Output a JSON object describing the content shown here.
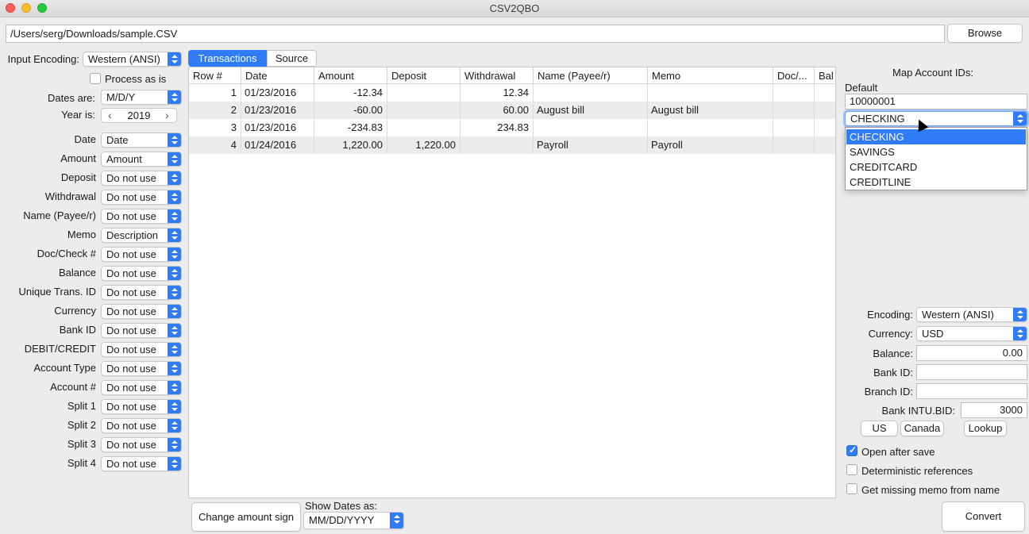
{
  "window": {
    "title": "CSV2QBO"
  },
  "file": {
    "path": "/Users/serg/Downloads/sample.CSV",
    "browse_label": "Browse"
  },
  "left": {
    "input_encoding_label": "Input Encoding:",
    "input_encoding_value": "Western (ANSI)",
    "process_as_is_label": "Process as is",
    "dates_are_label": "Dates are:",
    "dates_are_value": "M/D/Y",
    "year_label": "Year is:",
    "year_value": "2019",
    "year_prev": "‹",
    "year_next": "›",
    "mappings": [
      {
        "label": "Date",
        "value": "Date"
      },
      {
        "label": "Amount",
        "value": "Amount"
      },
      {
        "label": "Deposit",
        "value": "Do not use"
      },
      {
        "label": "Withdrawal",
        "value": "Do not use"
      },
      {
        "label": "Name (Payee/r)",
        "value": "Do not use"
      },
      {
        "label": "Memo",
        "value": "Description"
      },
      {
        "label": "Doc/Check #",
        "value": "Do not use"
      },
      {
        "label": "Balance",
        "value": "Do not use"
      },
      {
        "label": "Unique Trans. ID",
        "value": "Do not use"
      },
      {
        "label": "Currency",
        "value": "Do not use"
      },
      {
        "label": "Bank ID",
        "value": "Do not use"
      },
      {
        "label": "DEBIT/CREDIT",
        "value": "Do not use"
      },
      {
        "label": "Account Type",
        "value": "Do not use"
      },
      {
        "label": "Account #",
        "value": "Do not use"
      },
      {
        "label": "Split 1",
        "value": "Do not use"
      },
      {
        "label": "Split 2",
        "value": "Do not use"
      },
      {
        "label": "Split 3",
        "value": "Do not use"
      },
      {
        "label": "Split 4",
        "value": "Do not use"
      }
    ]
  },
  "tabs": [
    {
      "label": "Transactions"
    },
    {
      "label": "Source"
    }
  ],
  "table": {
    "columns": [
      "Row #",
      "Date",
      "Amount",
      "Deposit",
      "Withdrawal",
      "Name (Payee/r)",
      "Memo",
      "Doc/...",
      "Bal"
    ],
    "rows": [
      [
        "1",
        "01/23/2016",
        "-12.34",
        "",
        "12.34",
        "",
        "",
        "",
        ""
      ],
      [
        "2",
        "01/23/2016",
        "-60.00",
        "",
        "60.00",
        "August bill",
        "August bill",
        "",
        ""
      ],
      [
        "3",
        "01/23/2016",
        "-234.83",
        "",
        "234.83",
        "",
        "",
        "",
        ""
      ],
      [
        "4",
        "01/24/2016",
        "1,220.00",
        "1,220.00",
        "",
        "Payroll",
        "Payroll",
        "",
        ""
      ]
    ]
  },
  "bottom": {
    "change_sign_label": "Change amount sign",
    "show_dates_label": "Show Dates as:",
    "show_dates_value": "MM/DD/YYYY"
  },
  "right": {
    "map_title": "Map Account IDs:",
    "default_label": "Default",
    "account_id": "10000001",
    "account_type_value": "CHECKING",
    "account_type_options": [
      "CHECKING",
      "SAVINGS",
      "CREDITCARD",
      "CREDITLINE"
    ],
    "encoding_label": "Encoding:",
    "encoding_value": "Western (ANSI)",
    "currency_label": "Currency:",
    "currency_value": "USD",
    "balance_label": "Balance:",
    "balance_value": "0.00",
    "bank_id_label": "Bank ID:",
    "bank_id_value": "",
    "branch_id_label": "Branch ID:",
    "branch_id_value": "",
    "intu_label": "Bank INTU.BID:",
    "intu_value": "3000",
    "us_label": "US",
    "canada_label": "Canada",
    "lookup_label": "Lookup",
    "open_after_save_label": "Open after save",
    "deterministic_label": "Deterministic references",
    "missing_memo_label": "Get missing memo from name",
    "convert_label": "Convert"
  },
  "colors": {
    "accent": "#2f7cf6",
    "window_bg": "#ececec"
  }
}
